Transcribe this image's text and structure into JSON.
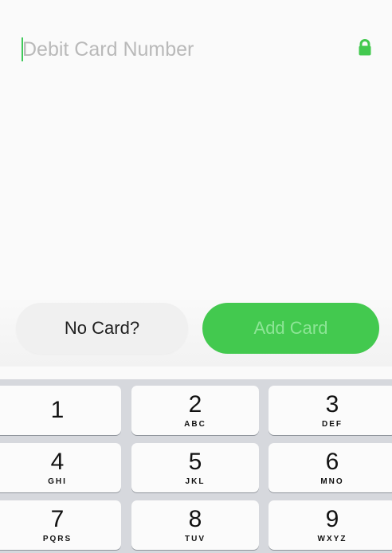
{
  "form": {
    "card_number_placeholder": "Debit Card Number",
    "card_number_value": ""
  },
  "actions": {
    "no_card_label": "No Card?",
    "add_card_label": "Add Card"
  },
  "keypad": {
    "keys": [
      {
        "digit": "1",
        "letters": ""
      },
      {
        "digit": "2",
        "letters": "ABC"
      },
      {
        "digit": "3",
        "letters": "DEF"
      },
      {
        "digit": "4",
        "letters": "GHI"
      },
      {
        "digit": "5",
        "letters": "JKL"
      },
      {
        "digit": "6",
        "letters": "MNO"
      },
      {
        "digit": "7",
        "letters": "PQRS"
      },
      {
        "digit": "8",
        "letters": "TUV"
      },
      {
        "digit": "9",
        "letters": "WXYZ"
      }
    ]
  },
  "colors": {
    "accent_green": "#43c94f",
    "add_card_text": "#8de596",
    "placeholder": "#b9b9b9",
    "keypad_background": "#d6d8dd"
  },
  "icons": {
    "lock": "lock-icon"
  }
}
